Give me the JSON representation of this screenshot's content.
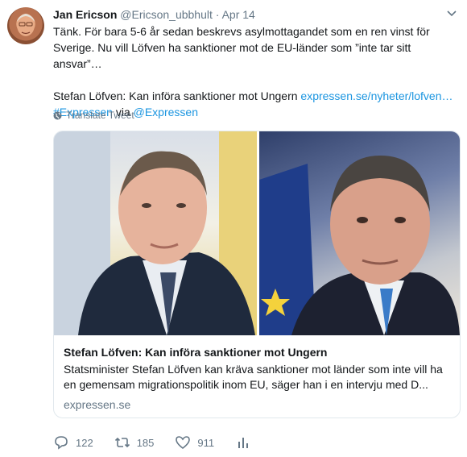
{
  "tweet": {
    "author_name": "Jan Ericson",
    "handle": "@Ericson_ubbhult",
    "separator": "·",
    "date": "Apr 14",
    "text_main": "Tänk. För bara 5-6 år sedan beskrevs asylmottagandet som en ren vinst för Sverige. Nu vill Löfven ha sanktioner mot de EU-länder som ”inte tar sitt ansvar”…",
    "text_headline": "Stefan Löfven: Kan införa sanktioner mot Ungern ",
    "text_link": "expressen.se/nyheter/lofven…",
    "hashtag": "#Expressen",
    "via_word": " via ",
    "mention": "@Expressen",
    "translate_label": "Translate Tweet"
  },
  "card": {
    "title": "Stefan Löfven: Kan införa sanktioner mot Ungern",
    "description": "Statsminister Stefan Löfven kan kräva sanktioner mot länder som inte vill ha en gemensam migrationspolitik inom EU, säger han i en intervju med D...",
    "domain": "expressen.se"
  },
  "actions": {
    "reply_count": "122",
    "retweet_count": "185",
    "like_count": "911"
  },
  "icons": {
    "caret": "chevron-down-icon",
    "translate": "globe-icon",
    "reply": "reply-icon",
    "retweet": "retweet-icon",
    "like": "heart-icon",
    "analytics": "analytics-icon"
  },
  "colors": {
    "link": "#1b95e0",
    "muted": "#657786",
    "border": "#e1e8ed"
  }
}
